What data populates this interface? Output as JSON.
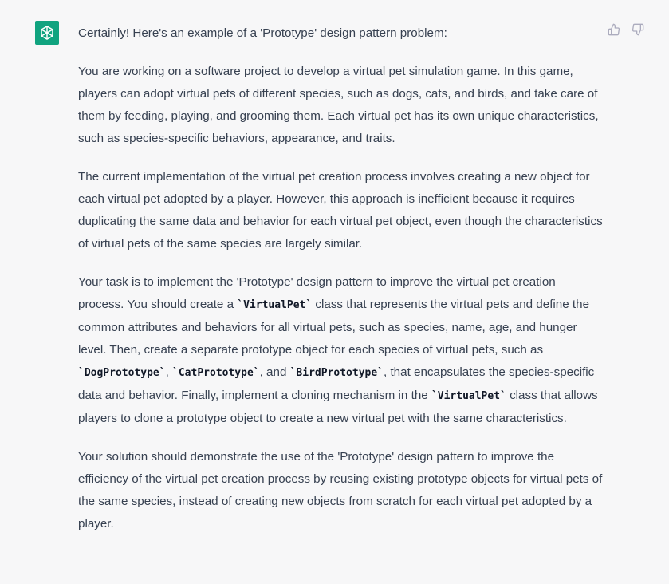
{
  "message": {
    "avatar_icon": "openai-logo-icon",
    "avatar_color": "#10a37f",
    "actions": {
      "thumbs_up_icon": "thumbs-up-icon",
      "thumbs_down_icon": "thumbs-down-icon"
    },
    "intro": "Certainly! Here's an example of a 'Prototype' design pattern problem:",
    "p1": "You are working on a software project to develop a virtual pet simulation game. In this game, players can adopt virtual pets of different species, such as dogs, cats, and birds, and take care of them by feeding, playing, and grooming them. Each virtual pet has its own unique characteristics, such as species-specific behaviors, appearance, and traits.",
    "p2": "The current implementation of the virtual pet creation process involves creating a new object for each virtual pet adopted by a player. However, this approach is inefficient because it requires duplicating the same data and behavior for each virtual pet object, even though the characteristics of virtual pets of the same species are largely similar.",
    "p3": {
      "t1": "Your task is to implement the 'Prototype' design pattern to improve the virtual pet creation process. You should create a ",
      "c1": "`VirtualPet`",
      "t2": " class that represents the virtual pets and define the common attributes and behaviors for all virtual pets, such as species, name, age, and hunger level. Then, create a separate prototype object for each species of virtual pets, such as ",
      "c2": "`DogPrototype`",
      "t3": ", ",
      "c3": "`CatPrototype`",
      "t4": ", and ",
      "c4": "`BirdPrototype`",
      "t5": ", that encapsulates the species-specific data and behavior. Finally, implement a cloning mechanism in the ",
      "c5": "`VirtualPet`",
      "t6": " class that allows players to clone a prototype object to create a new virtual pet with the same characteristics."
    },
    "p4": "Your solution should demonstrate the use of the 'Prototype' design pattern to improve the efficiency of the virtual pet creation process by reusing existing prototype objects for virtual pets of the same species, instead of creating new objects from scratch for each virtual pet adopted by a player."
  }
}
